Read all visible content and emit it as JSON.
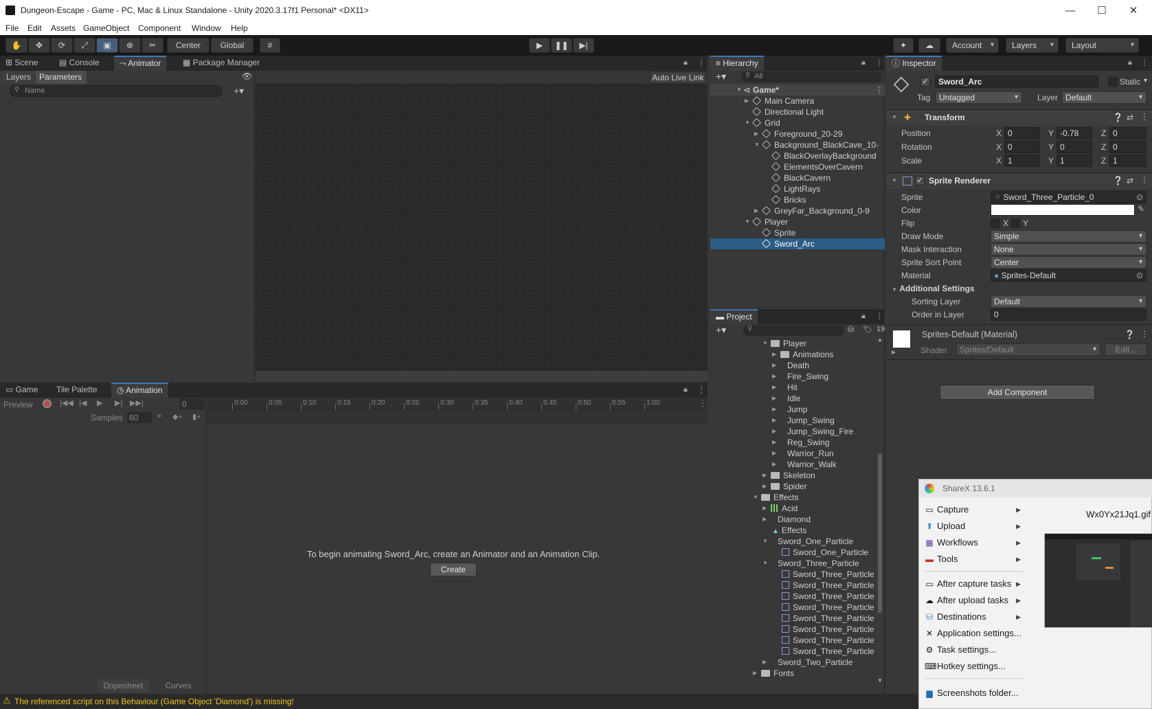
{
  "window": {
    "title": "Dungeon-Escape - Game - PC, Mac & Linux Standalone - Unity 2020.3.17f1 Personal* <DX11>",
    "minimize": "—",
    "maximize": "☐",
    "close": "✕"
  },
  "menu": [
    "File",
    "Edit",
    "Assets",
    "GameObject",
    "Component",
    "Window",
    "Help"
  ],
  "toolbar": {
    "pivot": "Center",
    "space": "Global",
    "account": "Account",
    "layers": "Layers",
    "layout": "Layout"
  },
  "top_left_tabs": [
    "Scene",
    "Console",
    "Animator",
    "Package Manager"
  ],
  "animator": {
    "layers_tab": "Layers",
    "parameters_tab": "Parameters",
    "search_placeholder": "Name",
    "auto_live_link": "Auto Live Link"
  },
  "bottom_left_tabs": [
    "Game",
    "Tile Palette",
    "Animation"
  ],
  "animation": {
    "preview": "Preview",
    "frame": "0",
    "samples_label": "Samples",
    "samples_value": "60",
    "ticks": [
      "0:00",
      "0:05",
      "0:10",
      "0:15",
      "0:20",
      "0:25",
      "0:30",
      "0:35",
      "0:40",
      "0:45",
      "0:50",
      "0:55",
      "1:00"
    ],
    "message": "To begin animating Sword_Arc, create an Animator and an Animation Clip.",
    "create_button": "Create",
    "dopesheet": "Dopesheet",
    "curves": "Curves"
  },
  "hierarchy": {
    "title": "Hierarchy",
    "search_placeholder": "All",
    "items": [
      "Game*",
      "Main Camera",
      "Directional Light",
      "Grid",
      "Foreground_20-29",
      "Background_BlackCave_10-",
      "BlackOverlayBackground",
      "ElementsOverCavern",
      "BlackCavern",
      "LightRays",
      "Bricks",
      "GreyFar_Background_0-9",
      "Player",
      "Sprite",
      "Sword_Arc"
    ]
  },
  "project": {
    "title": "Project",
    "hidden_count": "19",
    "items": [
      "Player",
      "Animations",
      "Death",
      "Fire_Swing",
      "Hit",
      "Idle",
      "Jump",
      "Jump_Swing",
      "Jump_Swing_Fire",
      "Reg_Swing",
      "Warrior_Run",
      "Warrior_Walk",
      "Skeleton",
      "Spider",
      "Effects",
      "Acid",
      "Diamond",
      "Effects",
      "Sword_One_Particle",
      "Sword_One_Particle",
      "Sword_Three_Particle",
      "Sword_Three_Particle",
      "Sword_Three_Particle",
      "Sword_Three_Particle",
      "Sword_Three_Particle",
      "Sword_Three_Particle",
      "Sword_Three_Particle",
      "Sword_Three_Particle",
      "Sword_Three_Particle",
      "Sword_Two_Particle",
      "Fonts"
    ]
  },
  "inspector": {
    "title": "Inspector",
    "object_name": "Sword_Arc",
    "static_label": "Static",
    "tag_label": "Tag",
    "tag_value": "Untagged",
    "layer_label": "Layer",
    "layer_value": "Default",
    "transform": {
      "title": "Transform",
      "position_label": "Position",
      "rotation_label": "Rotation",
      "scale_label": "Scale",
      "x": "X",
      "y": "Y",
      "z": "Z",
      "position": [
        "0",
        "-0.78",
        "0"
      ],
      "rotation": [
        "0",
        "0",
        "0"
      ],
      "scale": [
        "1",
        "1",
        "1"
      ]
    },
    "sprite_renderer": {
      "title": "Sprite Renderer",
      "sprite_label": "Sprite",
      "sprite_value": "Sword_Three_Particle_0",
      "color_label": "Color",
      "flip_label": "Flip",
      "flip_x": "X",
      "flip_y": "Y",
      "draw_mode_label": "Draw Mode",
      "draw_mode": "Simple",
      "mask_label": "Mask Interaction",
      "mask": "None",
      "sort_point_label": "Sprite Sort Point",
      "sort_point": "Center",
      "material_label": "Material",
      "material": "Sprites-Default",
      "additional": "Additional Settings",
      "sorting_layer_label": "Sorting Layer",
      "sorting_layer": "Default",
      "order_label": "Order in Layer",
      "order": "0"
    },
    "material_block": {
      "name": "Sprites-Default (Material)",
      "shader_label": "Shader",
      "shader": "Sprites/Default",
      "edit": "Edit..."
    },
    "add_component": "Add Component"
  },
  "status_message": "The referenced script on this Behaviour (Game Object 'Diamond') is missing!",
  "sharex": {
    "title": "ShareX 13.6.1",
    "file": "Wx0Yx21Jq1.gif",
    "items": [
      "Capture",
      "Upload",
      "Workflows",
      "Tools",
      "After capture tasks",
      "After upload tasks",
      "Destinations",
      "Application settings...",
      "Task settings...",
      "Hotkey settings...",
      "Screenshots folder..."
    ]
  },
  "colors": {
    "accent": "#2c5d87",
    "panel": "#383838",
    "warning": "#f0c419"
  }
}
